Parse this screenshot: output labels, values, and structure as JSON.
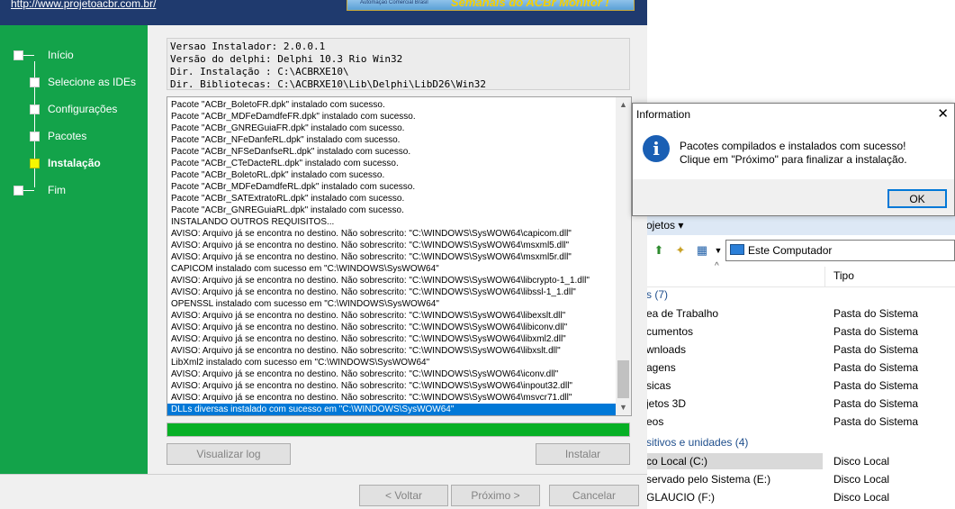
{
  "installer": {
    "banner_link": "http://www.projetoacbr.com.br/",
    "banner_logo_small": "Automação Comercial Brasil",
    "banner_logo_text": "Semanais do ACBr Monitor !",
    "steps": [
      {
        "label": "Início",
        "active": false
      },
      {
        "label": "Selecione as IDEs",
        "active": false
      },
      {
        "label": "Configurações",
        "active": false
      },
      {
        "label": "Pacotes",
        "active": false
      },
      {
        "label": "Instalação",
        "active": true
      },
      {
        "label": "Fim",
        "active": false
      }
    ],
    "info_lines": [
      "Versao Instalador: 2.0.0.1",
      "Versão do delphi: Delphi 10.3 Rio Win32",
      "Dir. Instalação : C:\\ACBRXE10\\",
      "Dir. Bibliotecas: C:\\ACBRXE10\\Lib\\Delphi\\LibD26\\Win32"
    ],
    "log_lines": [
      "Pacote \"ACBr_BoletoFR.dpk\" instalado com sucesso.",
      "Pacote \"ACBr_MDFeDamdfeFR.dpk\" instalado com sucesso.",
      "Pacote \"ACBr_GNREGuiaFR.dpk\" instalado com sucesso.",
      "Pacote \"ACBr_NFeDanfeRL.dpk\" instalado com sucesso.",
      "Pacote \"ACBr_NFSeDanfseRL.dpk\" instalado com sucesso.",
      "Pacote \"ACBr_CTeDacteRL.dpk\" instalado com sucesso.",
      "Pacote \"ACBr_BoletoRL.dpk\" instalado com sucesso.",
      "Pacote \"ACBr_MDFeDamdfeRL.dpk\" instalado com sucesso.",
      "Pacote \"ACBr_SATExtratoRL.dpk\" instalado com sucesso.",
      "Pacote \"ACBr_GNREGuiaRL.dpk\" instalado com sucesso.",
      "INSTALANDO OUTROS REQUISITOS...",
      "AVISO: Arquivo já se encontra no destino. Não sobrescrito: \"C:\\WINDOWS\\SysWOW64\\capicom.dll\"",
      "AVISO: Arquivo já se encontra no destino. Não sobrescrito: \"C:\\WINDOWS\\SysWOW64\\msxml5.dll\"",
      "AVISO: Arquivo já se encontra no destino. Não sobrescrito: \"C:\\WINDOWS\\SysWOW64\\msxml5r.dll\"",
      "CAPICOM instalado com sucesso em \"C:\\WINDOWS\\SysWOW64\"",
      "AVISO: Arquivo já se encontra no destino. Não sobrescrito: \"C:\\WINDOWS\\SysWOW64\\libcrypto-1_1.dll\"",
      "AVISO: Arquivo já se encontra no destino. Não sobrescrito: \"C:\\WINDOWS\\SysWOW64\\libssl-1_1.dll\"",
      "OPENSSL instalado com sucesso em \"C:\\WINDOWS\\SysWOW64\"",
      "AVISO: Arquivo já se encontra no destino. Não sobrescrito: \"C:\\WINDOWS\\SysWOW64\\libexslt.dll\"",
      "AVISO: Arquivo já se encontra no destino. Não sobrescrito: \"C:\\WINDOWS\\SysWOW64\\libiconv.dll\"",
      "AVISO: Arquivo já se encontra no destino. Não sobrescrito: \"C:\\WINDOWS\\SysWOW64\\libxml2.dll\"",
      "AVISO: Arquivo já se encontra no destino. Não sobrescrito: \"C:\\WINDOWS\\SysWOW64\\libxslt.dll\"",
      "LibXml2 instalado com sucesso em \"C:\\WINDOWS\\SysWOW64\"",
      "AVISO: Arquivo já se encontra no destino. Não sobrescrito: \"C:\\WINDOWS\\SysWOW64\\iconv.dll\"",
      "AVISO: Arquivo já se encontra no destino. Não sobrescrito: \"C:\\WINDOWS\\SysWOW64\\inpout32.dll\"",
      "AVISO: Arquivo já se encontra no destino. Não sobrescrito: \"C:\\WINDOWS\\SysWOW64\\msvcr71.dll\"",
      "DLLs diversas instalado com sucesso em \"C:\\WINDOWS\\SysWOW64\""
    ],
    "selected_log_index": 26,
    "progress_percent": 100,
    "progress_color": "#06b025",
    "nav_color": "#13a34a",
    "buttons": {
      "view_log": "Visualizar log",
      "install": "Instalar",
      "back": "< Voltar",
      "next": "Próximo >",
      "cancel": "Cancelar"
    }
  },
  "dialog": {
    "title": "Information",
    "icon": "info-icon",
    "message_line1": "Pacotes compilados e instalados com sucesso!",
    "message_line2": "Clique em \"Próximo\" para finalizar a instalação.",
    "ok_label": "OK"
  },
  "explorer": {
    "toolbar_label": "ojetos ▾",
    "address": "Este Computador",
    "column_type": "Tipo",
    "folders_group": "s (7)",
    "folders": [
      {
        "name": "ea de Trabalho",
        "type": "Pasta do Sistema"
      },
      {
        "name": "cumentos",
        "type": "Pasta do Sistema"
      },
      {
        "name": "wnloads",
        "type": "Pasta do Sistema"
      },
      {
        "name": "agens",
        "type": "Pasta do Sistema"
      },
      {
        "name": "sicas",
        "type": "Pasta do Sistema"
      },
      {
        "name": "jetos 3D",
        "type": "Pasta do Sistema"
      },
      {
        "name": "eos",
        "type": "Pasta do Sistema"
      }
    ],
    "drives_group": "sitivos e unidades (4)",
    "drives": [
      {
        "name": "co Local (C:)",
        "type": "Disco Local",
        "selected": true
      },
      {
        "name": "servado pelo Sistema (E:)",
        "type": "Disco Local",
        "selected": false
      },
      {
        "name": "GLAUCIO (F:)",
        "type": "Disco Local",
        "selected": false
      }
    ]
  }
}
